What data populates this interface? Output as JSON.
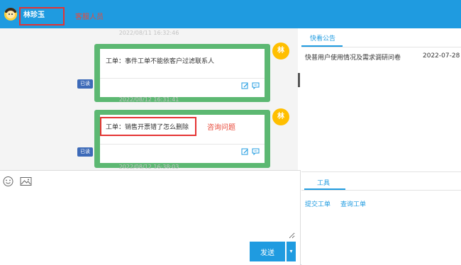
{
  "header": {
    "user_name": "林珍玉",
    "annotation_label": "客服人员",
    "bg_color": "#1f9be0"
  },
  "chat": {
    "messages": [
      {
        "timestamp": "2022/08/11 16:32:46",
        "text": "工单：事件工单不能依客户过滤联系人",
        "avatar_char": "林",
        "status": "已读"
      },
      {
        "timestamp": "2022/08/12 16:31:41",
        "text": "工单：销售开票错了怎么删除",
        "avatar_char": "林",
        "status": "已读"
      }
    ],
    "trailing_timestamp": "2022/08/12 16:38:03",
    "question_note": "咨询问题",
    "bubble_color": "#5cb872",
    "avatar_color": "#ffbf00"
  },
  "compose": {
    "icons": [
      "smiley-icon",
      "image-icon"
    ],
    "send_label": "发送",
    "dropdown_glyph": "▾"
  },
  "sidebar": {
    "announcement_tab": "快看公告",
    "announcement": {
      "title": "快普用户使用情况及需求调研问卷",
      "date": "2022-07-28"
    },
    "tools_tab": "工具",
    "tools": [
      "提交工单",
      "查询工单"
    ]
  }
}
